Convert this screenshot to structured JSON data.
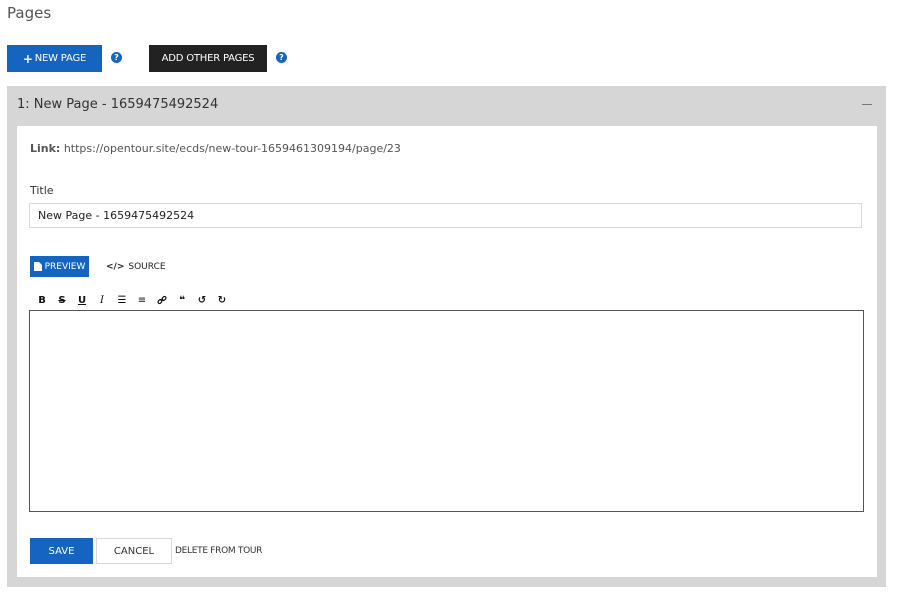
{
  "header": {
    "title": "Pages",
    "new_page_label": "NEW PAGE",
    "new_page_icon": "+",
    "add_other_label": "ADD OTHER PAGES",
    "help_glyph": "?"
  },
  "panel": {
    "heading": "1: New Page - 1659475492524",
    "link_label": "Link:",
    "link_url": "https://opentour.site/ecds/new-tour-1659461309194/page/23",
    "title_label": "Title",
    "title_value": "New Page - 1659475492524",
    "tabs": {
      "preview_label": "PREVIEW",
      "source_label": "SOURCE",
      "source_icon": "</>"
    },
    "toolbar": [
      {
        "name": "bold-button",
        "glyph": "B"
      },
      {
        "name": "strikethrough-button",
        "glyph": "S"
      },
      {
        "name": "underline-button",
        "glyph": "U"
      },
      {
        "name": "italic-button",
        "glyph": "I"
      },
      {
        "name": "bullet-list-button",
        "glyph": "☰"
      },
      {
        "name": "numbered-list-button",
        "glyph": "≡"
      },
      {
        "name": "link-button",
        "glyph": "🔗"
      },
      {
        "name": "quote-button",
        "glyph": "❝"
      },
      {
        "name": "undo-button",
        "glyph": "↺"
      },
      {
        "name": "redo-button",
        "glyph": "↻"
      }
    ],
    "actions": {
      "save_label": "SAVE",
      "cancel_label": "CANCEL",
      "delete_label": "DELETE FROM TOUR"
    }
  },
  "colors": {
    "primary": "#1565c0",
    "dark": "#222222",
    "panel_bg": "#d6d6d6"
  }
}
